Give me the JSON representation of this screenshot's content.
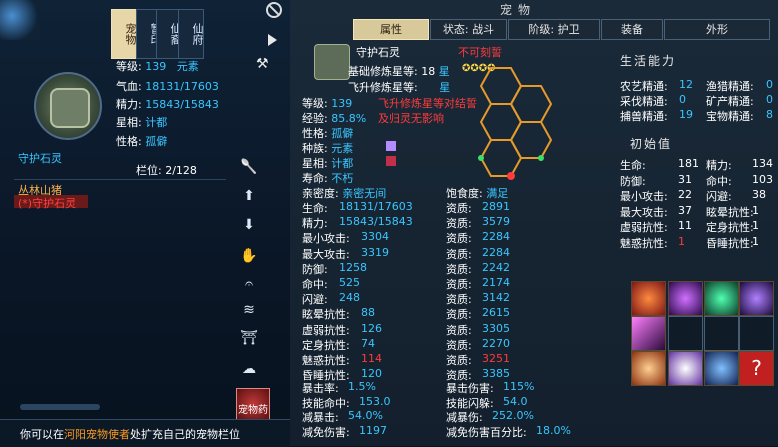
{
  "left_panel": {
    "vertical_tabs": [
      "宠物",
      "暂印",
      "仙裔",
      "仙府"
    ],
    "pet_name": "守护石灵",
    "stats": {
      "level_label": "等级:",
      "level": "139",
      "element": "元素",
      "hp_label": "气血:",
      "hp": "18131/17603",
      "spirit_label": "精力:",
      "spirit": "15843/15843",
      "star_label": "星相:",
      "star": "计都",
      "nature_label": "性格:",
      "nature": "孤僻"
    },
    "slot_label": "栏位:",
    "slot_value": "2/128",
    "pet_list": [
      "丛林山猪",
      "(*)守护石灵"
    ],
    "pet_medicine_label": "宠物药",
    "status_text_prefix": "你可以在",
    "status_text_link": "河阳宠物使者",
    "status_text_suffix": "处扩充自己的宠物栏位"
  },
  "right_panel": {
    "title": "宠物",
    "tabs": [
      "属性",
      "状态: 战斗",
      "阶级: 护卫",
      "装备",
      "外形"
    ],
    "pet_name": "守护石灵",
    "not_engraved": "不可刻誓",
    "basic_star_label": "基础修炼星等: 18",
    "basic_star_unit": "星",
    "fly_star_label": "飞升修炼星等:",
    "fly_star_unit": "星",
    "level_label": "等级:",
    "level": "139",
    "fly_note": "飞升修炼星等对结誓",
    "exp_label": "经验:",
    "exp": "85.8%",
    "exp_note": "及归灵无影响",
    "nature_label": "性格:",
    "nature": "孤僻",
    "race_label": "种族:",
    "race": "元素",
    "star_label": "星相:",
    "star": "计都",
    "life_label": "寿命:",
    "life": "不朽",
    "intimacy_label": "亲密度:",
    "intimacy": "亲密无间",
    "satiety_label": "饱食度:",
    "satiety": "满足",
    "attrs": [
      {
        "label": "生命:",
        "value": "18131/17603",
        "apt_label": "资质:",
        "apt": "2891",
        "apt_color": "#39c6ff"
      },
      {
        "label": "精力:",
        "value": "15843/15843",
        "apt_label": "资质:",
        "apt": "3579",
        "apt_color": "#39c6ff"
      },
      {
        "label": "最小攻击:",
        "value": "3304",
        "apt_label": "资质:",
        "apt": "2284",
        "apt_color": "#39c6ff"
      },
      {
        "label": "最大攻击:",
        "value": "3319",
        "apt_label": "资质:",
        "apt": "2284",
        "apt_color": "#39c6ff"
      },
      {
        "label": "防御:",
        "value": "1258",
        "apt_label": "资质:",
        "apt": "2242",
        "apt_color": "#39c6ff"
      },
      {
        "label": "命中:",
        "value": "525",
        "apt_label": "资质:",
        "apt": "2174",
        "apt_color": "#39c6ff"
      },
      {
        "label": "闪避:",
        "value": "248",
        "apt_label": "资质:",
        "apt": "3142",
        "apt_color": "#39c6ff"
      },
      {
        "label": "眩晕抗性:",
        "value": "88",
        "apt_label": "资质:",
        "apt": "2615",
        "apt_color": "#39c6ff"
      },
      {
        "label": "虚弱抗性:",
        "value": "126",
        "apt_label": "资质:",
        "apt": "3305",
        "apt_color": "#39c6ff"
      },
      {
        "label": "定身抗性:",
        "value": "74",
        "apt_label": "资质:",
        "apt": "2270",
        "apt_color": "#39c6ff"
      },
      {
        "label": "魅惑抗性:",
        "value": "114",
        "value_color": "#ff3b3b",
        "apt_label": "资质:",
        "apt": "3251",
        "apt_color": "#ff3b3b"
      },
      {
        "label": "昏睡抗性:",
        "value": "120",
        "apt_label": "资质:",
        "apt": "3385",
        "apt_color": "#39c6ff"
      }
    ],
    "extra": [
      {
        "label": "暴击率:",
        "value": "1.5%",
        "label2": "暴击伤害:",
        "value2": "115%"
      },
      {
        "label": "技能命中:",
        "value": "153.0",
        "label2": "技能闪躲:",
        "value2": "54.0"
      },
      {
        "label": "减暴击:",
        "value": "54.0%",
        "label2": "减暴伤:",
        "value2": "252.0%"
      },
      {
        "label": "减免伤害:",
        "value": "1197",
        "label2": "减免伤害百分比:",
        "value2": "18.0%"
      }
    ],
    "life_skill_title": "生活能力",
    "life_skills": [
      {
        "label": "农艺精通:",
        "value": "12",
        "label2": "渔猎精通:",
        "value2": "0"
      },
      {
        "label": "采伐精通:",
        "value": "0",
        "label2": "矿产精通:",
        "value2": "0"
      },
      {
        "label": "捕兽精通:",
        "value": "19",
        "label2": "宝物精通:",
        "value2": "8"
      }
    ],
    "init_title": "初始值",
    "init_values": [
      {
        "label": "生命:",
        "value": "181",
        "label2": "精力:",
        "value2": "134"
      },
      {
        "label": "防御:",
        "value": "31",
        "label2": "命中:",
        "value2": "103"
      },
      {
        "label": "最小攻击:",
        "value": "22",
        "label2": "闪避:",
        "value2": "38"
      },
      {
        "label": "最大攻击:",
        "value": "37",
        "label2": "眩晕抗性:",
        "value2": "1"
      },
      {
        "label": "虚弱抗性:",
        "value": "11",
        "label2": "定身抗性:",
        "value2": "1"
      },
      {
        "label": "魅惑抗性:",
        "value": "1",
        "value_color": "#ff3b3b",
        "label2": "昏睡抗性:",
        "value2": "1"
      }
    ],
    "colors": {
      "accent": "#39c6ff",
      "warning": "#ff3b3b",
      "gold": "#d8c99a"
    }
  }
}
